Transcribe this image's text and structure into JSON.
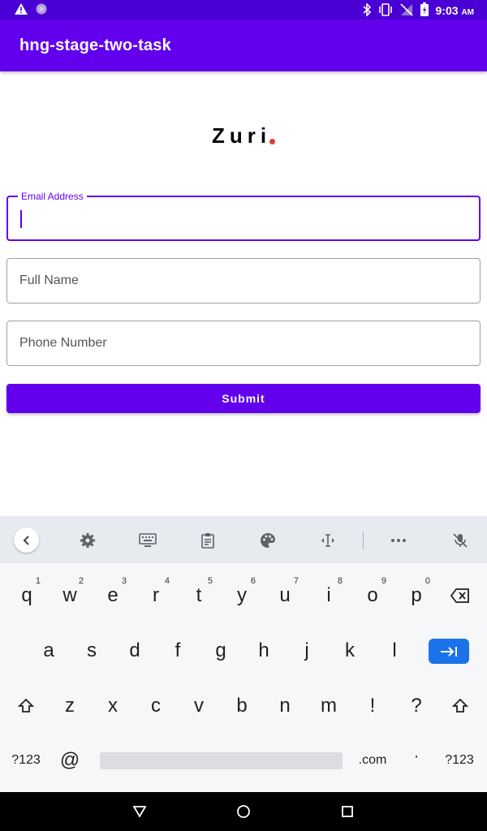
{
  "status_bar": {
    "time": "9:03",
    "ampm": "AM",
    "icons": [
      "warning-icon",
      "circle-notification-icon",
      "bluetooth-icon",
      "vibrate-icon",
      "no-signal-icon",
      "battery-charging-icon"
    ]
  },
  "app_bar": {
    "title": "hng-stage-two-task"
  },
  "logo": {
    "text": "Zuri",
    "dot_color": "#e53935"
  },
  "form": {
    "email": {
      "label": "Email Address",
      "value": ""
    },
    "full_name": {
      "placeholder": "Full Name",
      "value": ""
    },
    "phone": {
      "placeholder": "Phone Number",
      "value": ""
    },
    "submit_label": "Submit"
  },
  "keyboard": {
    "toolbar": [
      "back-chevron-icon",
      "settings-gear-icon",
      "keyboard-icon",
      "clipboard-icon",
      "palette-icon",
      "text-cursor-icon",
      "more-dots-icon",
      "mic-off-icon"
    ],
    "row1": [
      "q",
      "w",
      "e",
      "r",
      "t",
      "y",
      "u",
      "i",
      "o",
      "p"
    ],
    "row1_hints": [
      "1",
      "2",
      "3",
      "4",
      "5",
      "6",
      "7",
      "8",
      "9",
      "0"
    ],
    "row2": [
      "a",
      "s",
      "d",
      "f",
      "g",
      "h",
      "j",
      "k",
      "l"
    ],
    "row3": [
      "z",
      "x",
      "c",
      "v",
      "b",
      "n",
      "m",
      "!",
      "?"
    ],
    "row4": {
      "symbols_left": "?123",
      "at": "@",
      "dotcom": ".com",
      "period": "·",
      "symbols_right": "?123"
    }
  },
  "colors": {
    "primary": "#6200ee",
    "status_bar": "#4a00d4",
    "enter_key": "#1a73e8"
  }
}
